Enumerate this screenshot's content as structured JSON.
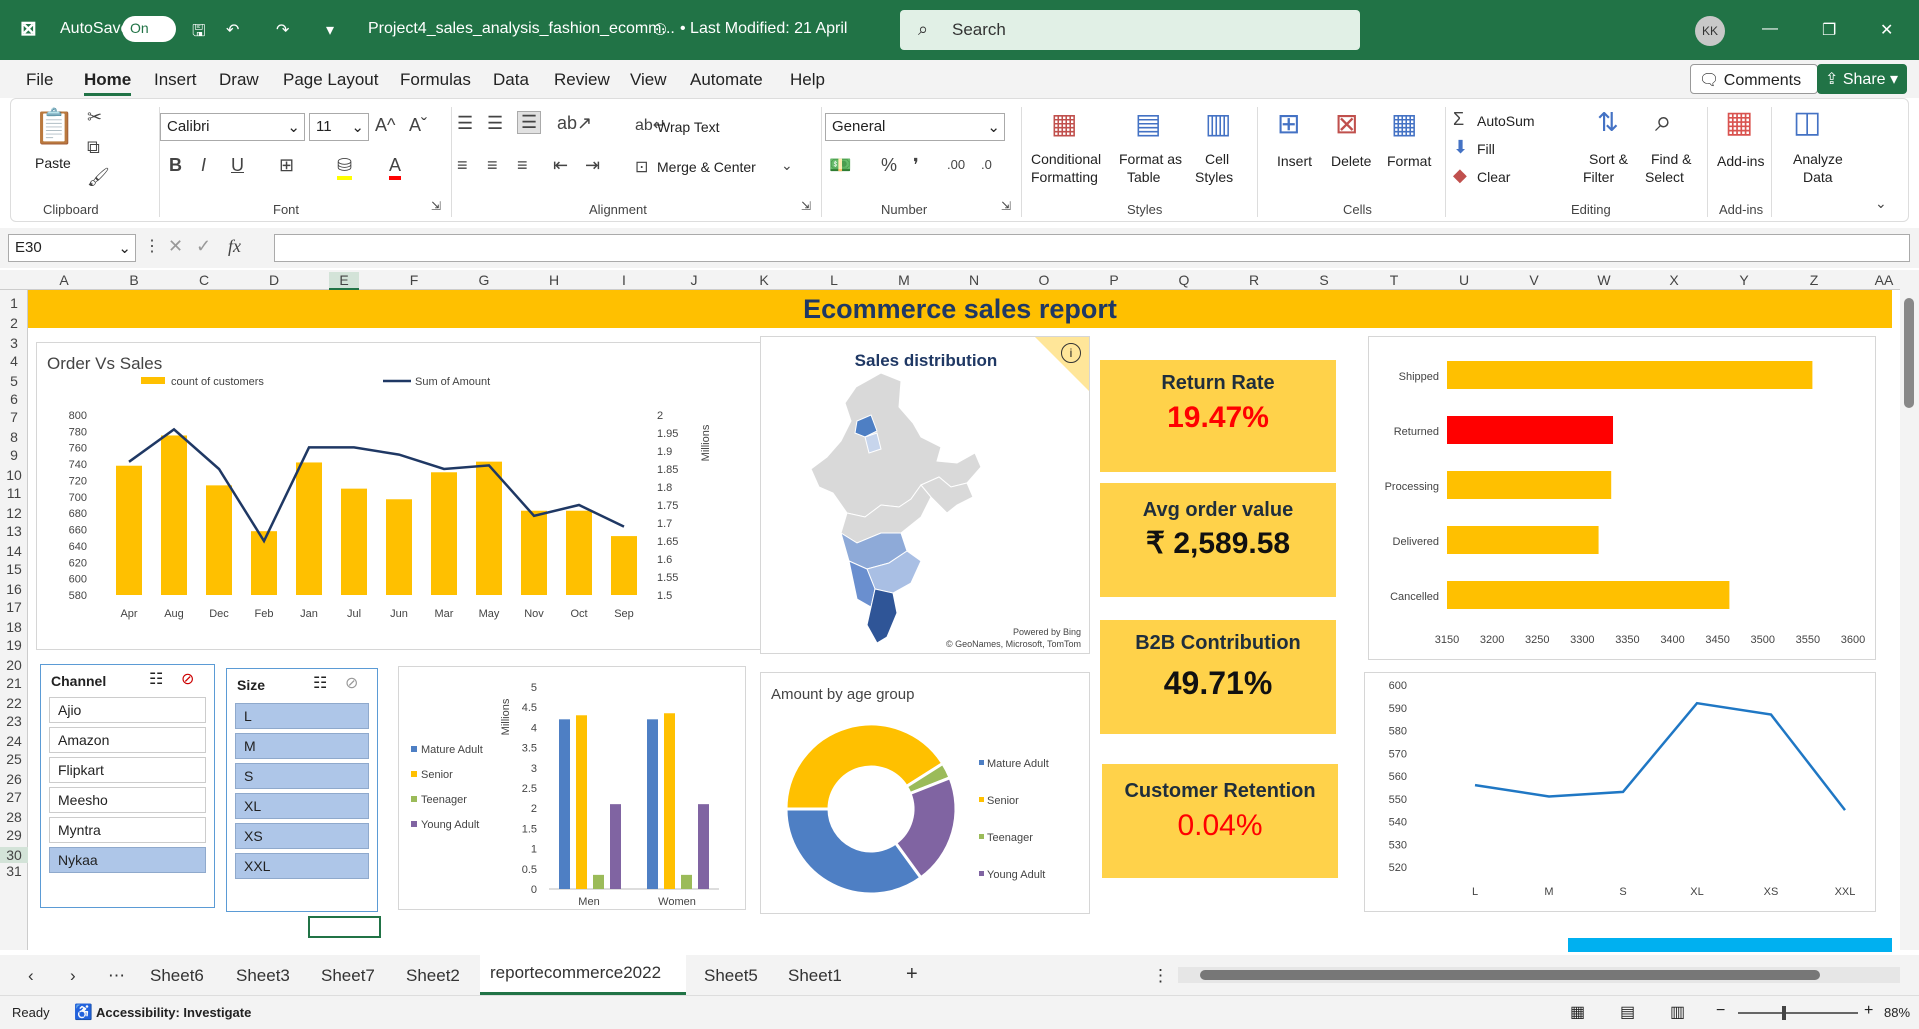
{
  "titlebar": {
    "autosave": "AutoSave",
    "autosave_state": "On",
    "filename": "Project4_sales_analysis_fashion_ecomm...",
    "modified": "• Last Modified: 21 April",
    "search": "Search",
    "avatar": "KK"
  },
  "ribbon_tabs": [
    "File",
    "Home",
    "Insert",
    "Draw",
    "Page Layout",
    "Formulas",
    "Data",
    "Review",
    "View",
    "Automate",
    "Help"
  ],
  "comments": "Comments",
  "share": "Share",
  "ribbon": {
    "paste": "Paste",
    "clipboard": "Clipboard",
    "font_name": "Calibri",
    "font_size": "11",
    "font_group": "Font",
    "wrap": "Wrap Text",
    "merge": "Merge & Center",
    "alignment": "Alignment",
    "number_format": "General",
    "number": "Number",
    "cond1": "Conditional",
    "cond2": "Formatting",
    "fmt1": "Format as",
    "fmt2": "Table",
    "cell1": "Cell",
    "cell2": "Styles",
    "styles": "Styles",
    "insert": "Insert",
    "delete": "Delete",
    "format": "Format",
    "cells": "Cells",
    "autosum": "AutoSum",
    "fill": "Fill",
    "clear": "Clear",
    "sort1": "Sort &",
    "sort2": "Filter",
    "find1": "Find &",
    "find2": "Select",
    "editing": "Editing",
    "addins": "Add-ins",
    "addins_grp": "Add-ins",
    "analyze1": "Analyze",
    "analyze2": "Data"
  },
  "formula": {
    "namebox": "E30",
    "fx": "fx"
  },
  "columns": [
    "A",
    "B",
    "C",
    "D",
    "E",
    "F",
    "G",
    "H",
    "I",
    "J",
    "K",
    "L",
    "M",
    "N",
    "O",
    "P",
    "Q",
    "R",
    "S",
    "T",
    "U",
    "V",
    "W",
    "X",
    "Y",
    "Z",
    "AA"
  ],
  "rows": [
    "1",
    "2",
    "3",
    "4",
    "5",
    "6",
    "7",
    "8",
    "9",
    "10",
    "11",
    "12",
    "13",
    "14",
    "15",
    "16",
    "17",
    "18",
    "19",
    "20",
    "21",
    "22",
    "23",
    "24",
    "25",
    "26",
    "27",
    "28",
    "29",
    "30",
    "31"
  ],
  "report": {
    "title": "Ecommerce sales report"
  },
  "kpis": {
    "return_title": "Return Rate",
    "return_value": "19.47%",
    "aov_title": "Avg order value",
    "aov_value": "₹ 2,589.58",
    "b2b_title": "B2B Contribution",
    "b2b_value": "49.71%",
    "ret_title": "Customer Retention",
    "ret_value": "0.04%"
  },
  "map": {
    "title": "Sales distribution",
    "credit1": "Powered by Bing",
    "credit2": "© GeoNames, Microsoft, TomTom"
  },
  "slicers": {
    "channel_title": "Channel",
    "channels": [
      "Ajio",
      "Amazon",
      "Flipkart",
      "Meesho",
      "Myntra",
      "Nykaa"
    ],
    "size_title": "Size",
    "sizes": [
      "L",
      "M",
      "S",
      "XL",
      "XS",
      "XXL"
    ]
  },
  "sheet_tabs": [
    "Sheet6",
    "Sheet3",
    "Sheet7",
    "Sheet2",
    "reportecommerce2022",
    "Sheet5",
    "Sheet1"
  ],
  "status": {
    "ready": "Ready",
    "accessibility": "Accessibility: Investigate",
    "zoom": "88%"
  },
  "colors": {
    "accent": "#217346",
    "yellow": "#ffc000",
    "navy": "#1f3864",
    "red": "#ff0000",
    "blue": "#4e7fc4",
    "green": "#9bbb59",
    "purple": "#8064a2"
  },
  "chart_data": [
    {
      "type": "bar",
      "title": "Order Vs Sales",
      "categories": [
        "Apr",
        "Aug",
        "Dec",
        "Feb",
        "Jan",
        "Jul",
        "Jun",
        "Mar",
        "May",
        "Nov",
        "Oct",
        "Sep"
      ],
      "series": [
        {
          "name": "count of customers",
          "axis": "left",
          "values": [
            738,
            775,
            714,
            658,
            742,
            710,
            697,
            730,
            743,
            683,
            683,
            652
          ]
        },
        {
          "name": "Sum of Amount",
          "axis": "right",
          "type": "line",
          "values": [
            1.87,
            1.96,
            1.85,
            1.65,
            1.91,
            1.91,
            1.89,
            1.85,
            1.86,
            1.72,
            1.75,
            1.69
          ]
        }
      ],
      "ylim": [
        580,
        800
      ],
      "y2lim": [
        1.5,
        2
      ],
      "y2label": "Millions",
      "yticks": [
        "800",
        "780",
        "760",
        "740",
        "720",
        "700",
        "680",
        "660",
        "640",
        "620",
        "600",
        "580"
      ],
      "y2ticks": [
        "2",
        "1.95",
        "1.9",
        "1.85",
        "1.8",
        "1.75",
        "1.7",
        "1.65",
        "1.6",
        "1.55",
        "1.5"
      ]
    },
    {
      "type": "bar",
      "orientation": "horizontal",
      "categories": [
        "Shipped",
        "Returned",
        "Processing",
        "Delivered",
        "Cancelled"
      ],
      "values": [
        3555,
        3334,
        3332,
        3318,
        3463
      ],
      "xlim": [
        3150,
        3600
      ],
      "xticks": [
        "3150",
        "3200",
        "3250",
        "3300",
        "3350",
        "3400",
        "3450",
        "3500",
        "3550",
        "3600"
      ]
    },
    {
      "type": "bar",
      "categories": [
        "Men",
        "Women"
      ],
      "series": [
        {
          "name": "Mature Adult",
          "values": [
            4.2,
            4.2
          ]
        },
        {
          "name": "Senior",
          "values": [
            4.3,
            4.35
          ]
        },
        {
          "name": "Teenager",
          "values": [
            0.35,
            0.35
          ]
        },
        {
          "name": "Young Adult",
          "values": [
            2.1,
            2.1
          ]
        }
      ],
      "ylim": [
        0,
        5
      ],
      "ylabel": "Millions",
      "yticks": [
        "5",
        "4.5",
        "4",
        "3.5",
        "3",
        "2.5",
        "2",
        "1.5",
        "1",
        "0.5",
        "0"
      ]
    },
    {
      "type": "pie",
      "title": "Amount by age group",
      "labels": [
        "Mature Adult",
        "Senior",
        "Teenager",
        "Young Adult"
      ],
      "values": [
        35,
        41,
        3,
        21
      ]
    },
    {
      "type": "line",
      "categories": [
        "L",
        "M",
        "S",
        "XL",
        "XS",
        "XXL"
      ],
      "values": [
        556,
        551,
        553,
        592,
        587,
        545
      ],
      "ylim": [
        520,
        600
      ],
      "yticks": [
        "600",
        "590",
        "580",
        "570",
        "560",
        "550",
        "540",
        "530",
        "520"
      ]
    }
  ]
}
